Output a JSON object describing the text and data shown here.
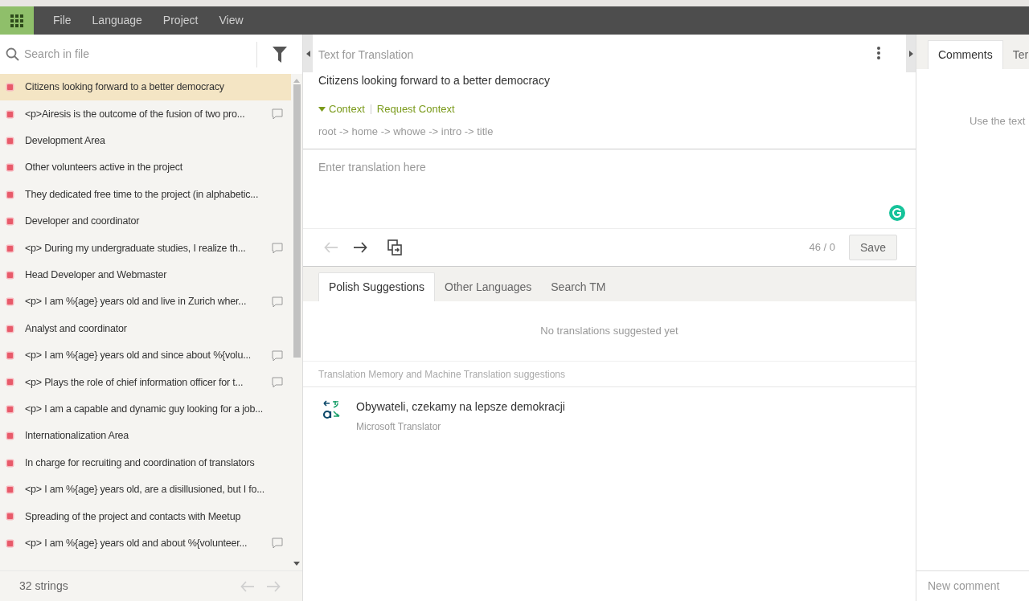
{
  "menu": [
    {
      "label": "File"
    },
    {
      "label": "Language"
    },
    {
      "label": "Project"
    },
    {
      "label": "View"
    }
  ],
  "sidebar": {
    "search": {
      "placeholder": "Search in file"
    },
    "items": [
      {
        "text": "Citizens looking forward to a better democracy",
        "selected": true,
        "has_comment": false
      },
      {
        "text": "<p>Airesis is the outcome of the fusion of two pro...",
        "selected": false,
        "has_comment": true
      },
      {
        "text": "Development Area",
        "selected": false,
        "has_comment": false
      },
      {
        "text": "Other volunteers active in the project",
        "selected": false,
        "has_comment": false
      },
      {
        "text": "They dedicated free time to the project (in alphabetic...",
        "selected": false,
        "has_comment": false
      },
      {
        "text": "Developer and coordinator",
        "selected": false,
        "has_comment": false
      },
      {
        "text": "<p> During my undergraduate studies, I realize th...",
        "selected": false,
        "has_comment": true
      },
      {
        "text": "Head Developer and Webmaster",
        "selected": false,
        "has_comment": false
      },
      {
        "text": "<p> I am %{age} years old and live in Zurich wher...",
        "selected": false,
        "has_comment": true
      },
      {
        "text": "Analyst and coordinator",
        "selected": false,
        "has_comment": false
      },
      {
        "text": "<p> I am %{age} years old and since about %{volu...",
        "selected": false,
        "has_comment": true
      },
      {
        "text": "<p> Plays the role of chief information officer for t...",
        "selected": false,
        "has_comment": true
      },
      {
        "text": "<p> I am a capable and dynamic guy looking for a job...",
        "selected": false,
        "has_comment": false
      },
      {
        "text": "Internationalization Area",
        "selected": false,
        "has_comment": false
      },
      {
        "text": "In charge for recruiting and coordination of translators",
        "selected": false,
        "has_comment": false
      },
      {
        "text": "<p> I am %{age} years old, are a disillusioned, but I fo...",
        "selected": false,
        "has_comment": false
      },
      {
        "text": "Spreading of the project and contacts with Meetup",
        "selected": false,
        "has_comment": false
      },
      {
        "text": "<p> I am %{age} years old and about %{volunteer...",
        "selected": false,
        "has_comment": true
      }
    ],
    "footer": {
      "count": "32 strings",
      "prev_disabled": true,
      "next_disabled": true
    }
  },
  "source": {
    "title": "Text for Translation",
    "text": "Citizens looking forward to a better democracy",
    "context_label": "Context",
    "context_expanded": true,
    "request_context": "Request Context",
    "path": "root -> home -> whowe -> intro -> title"
  },
  "editor": {
    "placeholder": "Enter translation here",
    "prev_disabled": true,
    "next_disabled": false,
    "counter": "46 / 0",
    "save": "Save"
  },
  "helpers": {
    "tabs": [
      {
        "label": "Polish Suggestions",
        "selected": true
      },
      {
        "label": "Other Languages",
        "selected": false
      },
      {
        "label": "Search TM",
        "selected": false
      }
    ],
    "empty": "No translations suggested yet",
    "section": "Translation Memory and Machine Translation suggestions",
    "suggestions": [
      {
        "text": "Obywateli, czekamy na lepsze demokracji",
        "source": "Microsoft Translator"
      }
    ]
  },
  "side": {
    "tabs": [
      {
        "label": "Comments",
        "selected": true
      },
      {
        "label": "Ter",
        "selected": false
      }
    ],
    "hint": "Use the text",
    "placeholder": "New comment"
  }
}
